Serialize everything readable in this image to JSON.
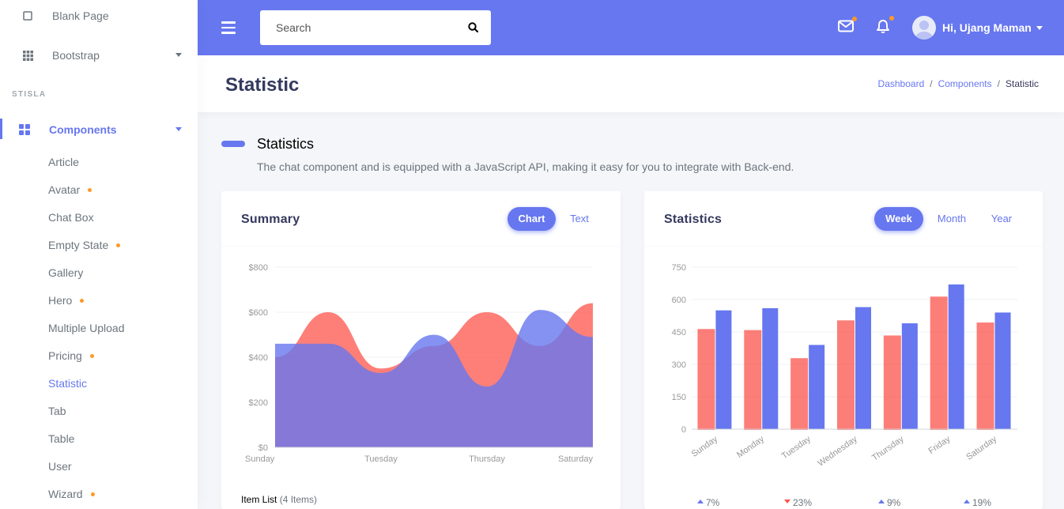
{
  "sidebar": {
    "top_items": [
      {
        "label": "Blank Page",
        "icon": "square-icon"
      },
      {
        "label": "Bootstrap",
        "icon": "grid-icon"
      }
    ],
    "header": "STISLA",
    "active_group": {
      "label": "Components",
      "icon": "th-large-icon"
    },
    "sub_items": [
      {
        "label": "Article",
        "dot": false
      },
      {
        "label": "Avatar",
        "dot": true
      },
      {
        "label": "Chat Box",
        "dot": false
      },
      {
        "label": "Empty State",
        "dot": true
      },
      {
        "label": "Gallery",
        "dot": false
      },
      {
        "label": "Hero",
        "dot": true
      },
      {
        "label": "Multiple Upload",
        "dot": false
      },
      {
        "label": "Pricing",
        "dot": true
      },
      {
        "label": "Statistic",
        "dot": false,
        "active": true
      },
      {
        "label": "Tab",
        "dot": false
      },
      {
        "label": "Table",
        "dot": false
      },
      {
        "label": "User",
        "dot": false
      },
      {
        "label": "Wizard",
        "dot": true
      }
    ]
  },
  "navbar": {
    "search_placeholder": "Search",
    "user_greeting": "Hi, Ujang Maman",
    "icons": [
      "menu-icon",
      "search-icon",
      "envelope-icon",
      "bell-icon"
    ]
  },
  "page": {
    "title": "Statistic",
    "breadcrumb": [
      "Dashboard",
      "Components",
      "Statistic"
    ],
    "section_title": "Statistics",
    "section_lead": "The chat component and is equipped with a JavaScript API, making it easy for you to integrate with Back-end."
  },
  "summary_card": {
    "title": "Summary",
    "tabs": [
      "Chart",
      "Text"
    ],
    "item_list_label": "Item List",
    "item_list_count": "(4 Items)"
  },
  "statistics_card": {
    "title": "Statistics",
    "tabs": [
      "Week",
      "Month",
      "Year"
    ],
    "footer_stats": [
      {
        "value": "7%",
        "direction": "up"
      },
      {
        "value": "23%",
        "direction": "down"
      },
      {
        "value": "9%",
        "direction": "up"
      },
      {
        "value": "19%",
        "direction": "up"
      }
    ]
  },
  "colors": {
    "primary": "#6777ef",
    "danger": "#fc544b",
    "warning": "#fc9a26"
  },
  "chart_data": [
    {
      "type": "area",
      "categories": [
        "Sunday",
        "Monday",
        "Tuesday",
        "Wednesday",
        "Thursday",
        "Friday",
        "Saturday"
      ],
      "x_tick_labels": [
        "Sunday",
        "Tuesday",
        "Thursday",
        "Saturday"
      ],
      "y_tick_labels": [
        "$0",
        "$200",
        "$400",
        "$600",
        "$800"
      ],
      "ylim": [
        0,
        800
      ],
      "series": [
        {
          "color": "#fc544b",
          "values": [
            400,
            600,
            350,
            450,
            600,
            450,
            640
          ]
        },
        {
          "color": "#6777ef",
          "values": [
            460,
            460,
            330,
            500,
            270,
            610,
            490
          ]
        }
      ]
    },
    {
      "type": "bar",
      "categories": [
        "Sunday",
        "Monday",
        "Tuesday",
        "Wednesday",
        "Thursday",
        "Friday",
        "Saturday"
      ],
      "y_tick_labels": [
        "0",
        "150",
        "300",
        "450",
        "600",
        "750"
      ],
      "ylim": [
        0,
        750
      ],
      "series": [
        {
          "color": "#fc544b",
          "values": [
            460,
            455,
            325,
            500,
            430,
            610,
            490
          ]
        },
        {
          "color": "#6777ef",
          "values": [
            550,
            560,
            390,
            565,
            490,
            670,
            540
          ]
        }
      ]
    }
  ]
}
